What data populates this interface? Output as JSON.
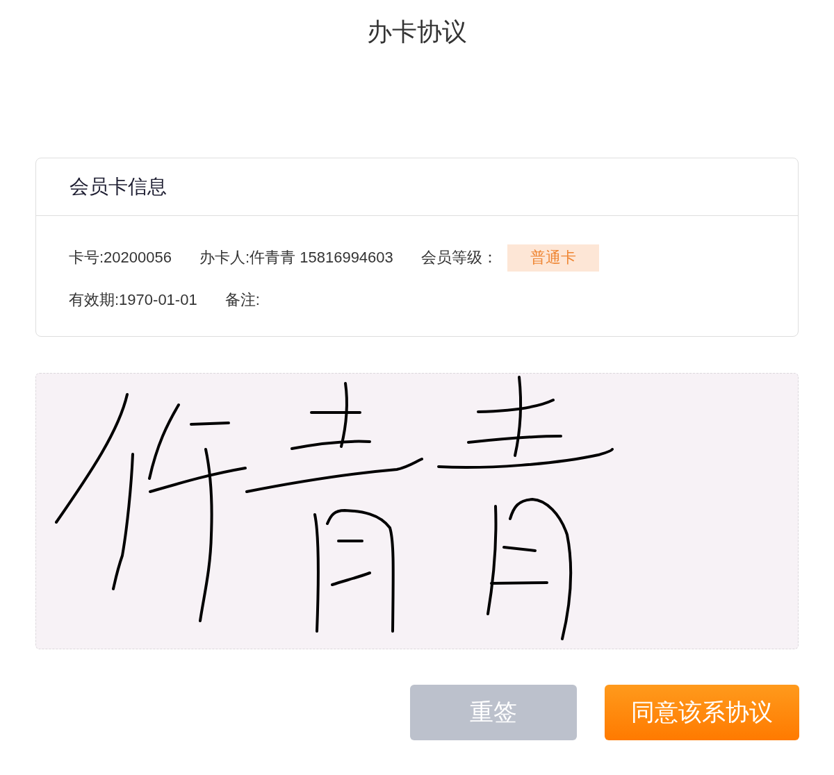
{
  "page": {
    "title": "办卡协议"
  },
  "card": {
    "title": "会员卡信息",
    "rows": [
      [
        {
          "kind": "text",
          "text": "卡号:20200056"
        },
        {
          "kind": "text",
          "text": "办卡人:仵青青 15816994603"
        },
        {
          "kind": "badge",
          "label": "会员等级：",
          "value": "普通卡"
        }
      ],
      [
        {
          "kind": "text",
          "text": "有效期:1970-01-01"
        },
        {
          "kind": "text",
          "text": "备注:"
        }
      ]
    ]
  },
  "signature_pad": {
    "signed": true
  },
  "buttons": [
    {
      "kind": "secondary",
      "label": "重签"
    },
    {
      "kind": "primary",
      "label": "同意该系协议"
    }
  ]
}
